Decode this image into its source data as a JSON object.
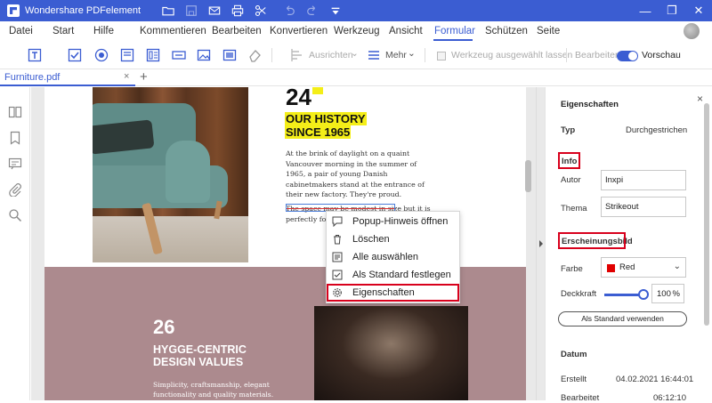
{
  "titlebar": {
    "app_title": "Wondershare PDFelement",
    "icons": [
      "folder-open-icon",
      "save-icon",
      "mail-icon",
      "print-icon",
      "scissors-icon",
      "undo-icon",
      "redo-icon",
      "quick-access-icon"
    ],
    "window_controls": [
      "—",
      "❐",
      "✕"
    ]
  },
  "menu": {
    "items": [
      "Datei",
      "Start",
      "Hilfe",
      "Kommentieren",
      "Bearbeiten",
      "Konvertieren",
      "Werkzeug",
      "Ansicht",
      "Formular",
      "Schützen",
      "Seite"
    ],
    "active": "Formular"
  },
  "toolbar": {
    "align_label": "Ausrichten",
    "more_label": "Mehr",
    "keep_tool_label": "Werkzeug ausgewählt lassen",
    "edit_label": "Bearbeiten",
    "preview_label": "Vorschau"
  },
  "tabs": {
    "doc_name": "Furniture.pdf",
    "close": "×",
    "add": "+"
  },
  "document": {
    "number_24": "24",
    "history_line1": "OUR HISTORY",
    "history_line2": "SINCE 1965",
    "body": "At the brink of daylight on a quaint Vancouver morning in the summer of 1965, a pair of young Danish cabinetmakers stand at the entrance of their new factory. They're proud.",
    "strike_text": "The space may be modest in size but it is perfectly for their hand",
    "number_26": "26",
    "hygge_line1": "HYGGE-CENTRIC",
    "hygge_line2": "DESIGN VALUES",
    "hygge_body": "Simplicity, craftsmanship, elegant functionality and quality materials."
  },
  "context_menu": {
    "items": [
      {
        "label": "Popup-Hinweis öffnen",
        "icon": "comment-icon"
      },
      {
        "label": "Löschen",
        "icon": "trash-icon"
      },
      {
        "label": "Alle auswählen",
        "icon": "select-all-icon"
      },
      {
        "label": "Als Standard festlegen",
        "icon": "checkbox-icon"
      },
      {
        "label": "Eigenschaften",
        "icon": "gear-icon"
      }
    ]
  },
  "properties": {
    "title": "Eigenschaften",
    "close": "×",
    "typ_label": "Typ",
    "typ_value": "Durchgestrichen",
    "info_heading": "Info",
    "autor_label": "Autor",
    "autor_value": "Inxpi",
    "thema_label": "Thema",
    "thema_value": "Strikeout",
    "appearance_heading": "Erscheinungsbild",
    "farbe_label": "Farbe",
    "farbe_value": "Red",
    "farbe_color": "#e00000",
    "deckkraft_label": "Deckkraft",
    "deckkraft_value": "100",
    "deckkraft_unit": "%",
    "std_button": "Als Standard verwenden",
    "datum_heading": "Datum",
    "erstellt_label": "Erstellt",
    "erstellt_value": "04.02.2021 16:44:01",
    "bearbeitet_label": "Bearbeitet",
    "bearbeitet_value": "06:12:10"
  },
  "colors": {
    "accent": "#3b5dd2",
    "highlight_yellow": "#f4ee18",
    "annotation_red": "#d8001c",
    "mauve": "#ac8a8e"
  }
}
